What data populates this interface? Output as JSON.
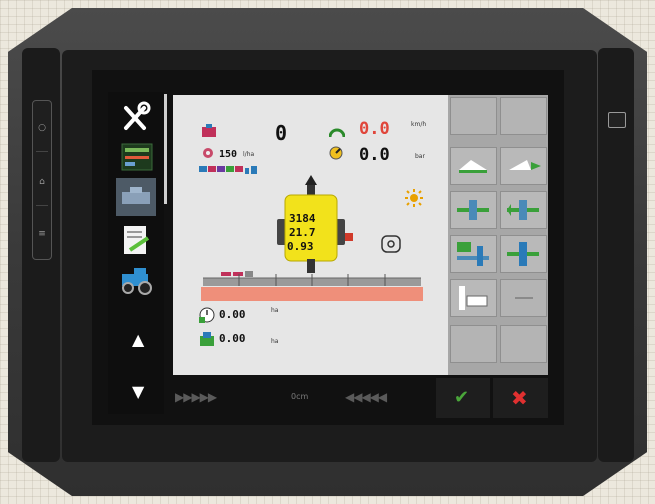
{
  "colors": {
    "screen_bg": "#e6e6e6",
    "accent_red": "#e0463b",
    "boom_red": "#ef8f7a",
    "sprayer_yellow": "#f2e21b",
    "ok_green": "#4aa63a",
    "cancel_red": "#e03030"
  },
  "left_keys": {
    "icons": [
      "power-icon",
      "home-icon",
      "menu-icon"
    ]
  },
  "nav": {
    "items": [
      {
        "name": "tools-icon"
      },
      {
        "name": "sprayer-view-icon"
      },
      {
        "name": "implement-icon"
      },
      {
        "name": "task-document-icon"
      },
      {
        "name": "tractor-icon"
      }
    ],
    "up_icon": "▲",
    "down_icon": "▼"
  },
  "status": {
    "tank_value": "0",
    "speed_value": "0.0",
    "speed_unit": "km/h",
    "rate_value": "150",
    "rate_unit": "l/ha",
    "pressure_value": "0.0",
    "pressure_unit": "bar"
  },
  "sprayer": {
    "line1": "3184",
    "line2": "21.7",
    "line3": "0.93"
  },
  "readouts": {
    "area_value": "0.00",
    "area_unit": "ha",
    "distance_value": "0.00",
    "distance_unit": "ha"
  },
  "bottom": {
    "left_arrows": "▶▶▶▶▶",
    "center_label": "0cm",
    "right_arrows": "◀◀◀◀◀",
    "ok_icon": "✔",
    "cancel_icon": "✖"
  }
}
